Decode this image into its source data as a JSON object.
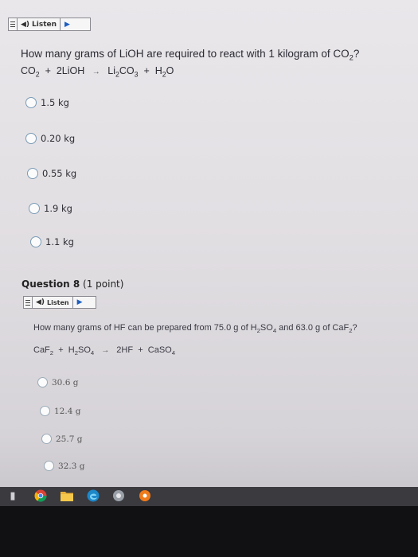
{
  "toolbar": {
    "listen_label": "Listen"
  },
  "question7": {
    "prompt": "How many grams of LiOH are required to react with 1 kilogram of CO",
    "prompt_sub": "2",
    "prompt_end": "?",
    "equation": {
      "r1": "CO",
      "r1_sub": "2",
      "plus1": "+",
      "r2": "2LiOH",
      "p1a": "Li",
      "p1_sub1": "2",
      "p1b": "CO",
      "p1_sub2": "3",
      "plus2": "+",
      "p2a": "H",
      "p2_sub": "2",
      "p2b": "O"
    },
    "options": [
      "1.5 kg",
      "0.20 kg",
      "0.55 kg",
      "1.9 kg",
      "1.1 kg"
    ]
  },
  "question8": {
    "title": "Question 8",
    "points": "(1 point)",
    "listen_label": "Listen",
    "prompt_a": "How many grams of HF can be prepared from 75.0 g of H",
    "prompt_s1": "2",
    "prompt_b": "SO",
    "prompt_s2": "4",
    "prompt_c": " and 63.0 g of CaF",
    "prompt_s3": "2",
    "prompt_d": "?",
    "equation": {
      "r1": "CaF",
      "r1_sub": "2",
      "plus1": "+",
      "r2a": "H",
      "r2_sub1": "2",
      "r2b": "SO",
      "r2_sub2": "4",
      "p1": "2HF",
      "plus2": "+",
      "p2": "CaSO",
      "p2_sub": "4"
    },
    "options": [
      "30.6 g",
      "12.4 g",
      "25.7 g",
      "32.3 g"
    ]
  },
  "taskbar": {
    "icons": [
      "recycle-bin-icon",
      "chrome-icon",
      "folder-icon",
      "edge-icon",
      "app-icon",
      "app-orange-icon"
    ]
  }
}
